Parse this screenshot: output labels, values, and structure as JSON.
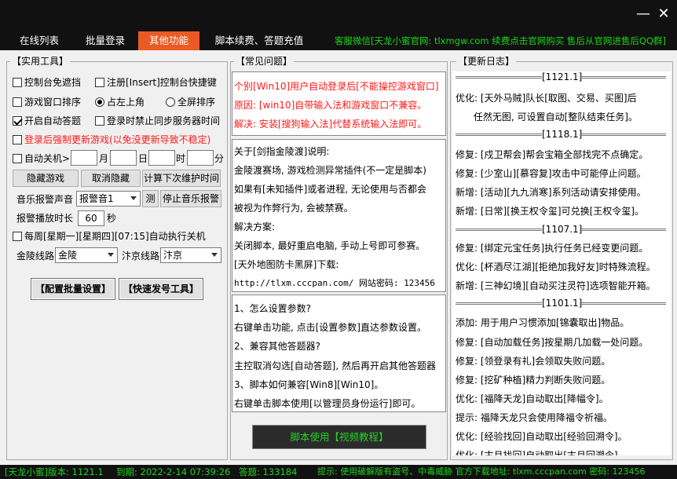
{
  "window": {
    "minimize_glyph": "—",
    "close_glyph": "✕"
  },
  "tabs": [
    {
      "label": "在线列表"
    },
    {
      "label": "批量登录"
    },
    {
      "label": "其他功能"
    },
    {
      "label": "脚本续费、答题充值"
    }
  ],
  "tab_notice": "客服微信[天龙小蜜官网: tlxmgw.com 续费点击官网购买 售后从官网进售后QQ群]",
  "tools": {
    "title": "【实用工具】",
    "console_no_block": "控制台免遮挡",
    "register_hotkey": "注册[Insert]控制台快捷键",
    "window_sort": "游戏窗口排序",
    "occupy_top_left": "占左上角",
    "full_screen_sort": "全屏排序",
    "auto_answer": "开启自动答题",
    "disable_sync_time": "登录时禁止同步服务器时间",
    "force_new_game": "登录后强制更新游戏(以免没更新导致不稳定)",
    "auto_shutdown": "自动关机>",
    "month": "月",
    "day": "日",
    "hour": "时",
    "minute": "分",
    "hide_game": "隐藏游戏",
    "cancel_hide": "取消隐藏",
    "calc_maintenance": "计算下次维护时间",
    "music_alarm_label": "音乐报警声音",
    "music_alarm_value": "报警音1",
    "test": "测",
    "stop_alarm": "停止音乐报警",
    "alarm_duration_label": "报警播放时长",
    "alarm_duration_value": "60",
    "seconds": "秒",
    "weekly_shutdown": "每周[星期一][星期四][07:15]自动执行关机",
    "jinling_label": "金陵线路",
    "jinling_value": "金陵",
    "bianjing_label": "汴京线路",
    "bianjing_value": "汴京",
    "config_batch": "【配置批量设置】",
    "quick_send": "【快速发号工具】"
  },
  "faq": {
    "title": "【常见问题】",
    "red_lines": [
      "个别[Win10]用户自动登录后[不能操控游戏窗口]",
      "原因: [win10]自带输入法和游戏窗口不兼容。",
      "解决: 安装[搜狗输入法]代替系统输入法即可。"
    ],
    "lines": [
      "关于[剑指金陵渡]说明:",
      "金陵渡赛场, 游戏检测异常插件(不一定是脚本)",
      "如果有[未知插件]或者进程, 无论使用与否都会",
      "被视为作弊行为, 会被禁赛。",
      "解决方案:",
      "关闭脚本, 最好重启电脑, 手动上号即可参赛。",
      "[天外地图防卡黑屏]下载:",
      "http://tlxm.cccpan.com/  网站密码: 123456"
    ],
    "qa": [
      "1、怎么设置参数?",
      "右键单击功能, 点击[设置参数]直达参数设置。",
      "2、兼容其他答题器?",
      "主控取消勾选[自动答题], 然后再开启其他答题器",
      "3、脚本如何兼容[Win8][Win10]。",
      "右键单击脚本使用[以管理员身份运行]即可。"
    ],
    "video_button": "脚本使用【视频教程】"
  },
  "changelog": {
    "title": "【更新日志】",
    "groups": [
      {
        "version": "[1121.1]",
        "items": [
          "优化: [天外马贼]队长[取图、交易、买图]后",
          "      任然无图, 可设置自动[整队结束任务]。"
        ]
      },
      {
        "version": "[1118.1]",
        "items": [
          "修复: [戍卫帮会]帮会宝箱全部找完不点确定。",
          "修复: [少室山][慕容复]攻击中可能停止问题。",
          "新增: [活动][九九消寒]系列活动请安排使用。",
          "新增: [日常][换王权令玺]可兑换[王权令玺]。"
        ]
      },
      {
        "version": "[1107.1]",
        "items": [
          "修复: [绑定元宝任务]执行任务已经变更问题。",
          "优化: [杯酒尽江湖][拒绝加我好友]时特殊流程。",
          "新增: [三神幻境][自动买注灵符]选项智能开箱。"
        ]
      },
      {
        "version": "[1101.1]",
        "items": [
          "添加: 用于用户习惯添加[锦囊取出]物品。",
          "修复: [自动加载任务]按星期几加载一处问题。",
          "修复: [领登录有礼]会领取失败问题。",
          "修复: [挖矿种植]精力判断失败问题。",
          "优化: [福降天龙]自动取出[降幅令]。",
          "提示: 福降天龙只会使用降福令祈福。",
          "优化: [经验找回]自动取出[经验回溯令]。",
          "优化: [古月找回]自动取出[古月回溯令]。"
        ]
      }
    ]
  },
  "status_bar": {
    "version": "[天龙小蜜]版本: 1121.1",
    "expiry": "到期: 2022-2-14 07:39:26",
    "answers": "答题: 133184",
    "tip": "提示: 使用破解版有盗号、中毒威胁 官方下载地址: tlxm.cccpan.com 密码: 123456"
  },
  "colors": {
    "active_tab": "#ea5a24",
    "accent_green": "#21d321",
    "warning_red": "#ff1a1a",
    "title_bg": "#111111"
  }
}
